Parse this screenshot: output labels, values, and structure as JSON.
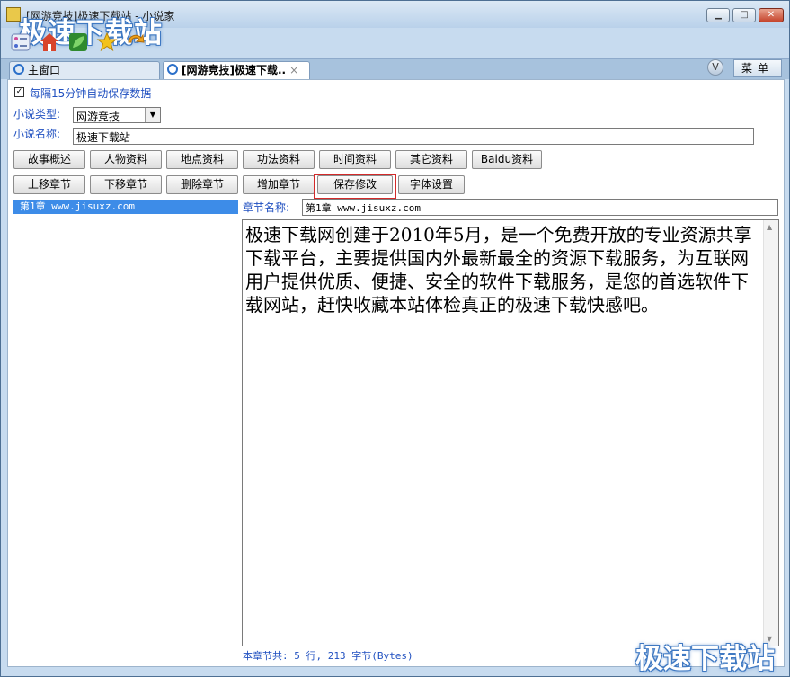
{
  "window": {
    "title": "[网游竞技]极速下载站 - 小说家",
    "watermark": "极速下载站",
    "minimize_icon": "minimize-icon",
    "maximize_icon": "maximize-icon",
    "close_icon": "close-icon"
  },
  "toolbar": {
    "icons": [
      "list-settings-icon",
      "home-icon",
      "leaf-icon",
      "star-icon",
      "refresh-icon"
    ]
  },
  "tabs": [
    {
      "label": "主窗口",
      "icon": "ie-icon"
    },
    {
      "label": "[网游竞技]极速下载..",
      "icon": "ie-icon",
      "close": "×"
    }
  ],
  "tabbar": {
    "dropdown": "V",
    "menu_label": "菜单"
  },
  "form": {
    "autosave_label": "每隔15分钟自动保存数据",
    "autosave_checked": "✓",
    "type_label": "小说类型:",
    "type_value": "网游竞技",
    "name_label": "小说名称:",
    "name_value": "极速下载站"
  },
  "buttons_row1": [
    "故事概述",
    "人物资料",
    "地点资料",
    "功法资料",
    "时间资料",
    "其它资料",
    "Baidu资料"
  ],
  "buttons_row2": [
    "上移章节",
    "下移章节",
    "删除章节",
    "增加章节",
    "保存修改",
    "字体设置"
  ],
  "chapters": [
    "第1章 www.jisuxz.com"
  ],
  "chapter_editor": {
    "name_label": "章节名称:",
    "name_value": "第1章 www.jisuxz.com",
    "body": "极速下载网创建于2010年5月，是一个免费开放的专业资源共享下载平台，主要提供国内外最新最全的资源下载服务，为互联网用户提供优质、便捷、安全的软件下载服务，是您的首选软件下载网站，赶快收藏本站体检真正的极速下载快感吧。",
    "status": "本章节共: 5 行, 213 字节(Bytes)"
  },
  "colors": {
    "accent": "#3d8ce8",
    "label": "#2050c0",
    "highlight": "#d32a2a"
  }
}
